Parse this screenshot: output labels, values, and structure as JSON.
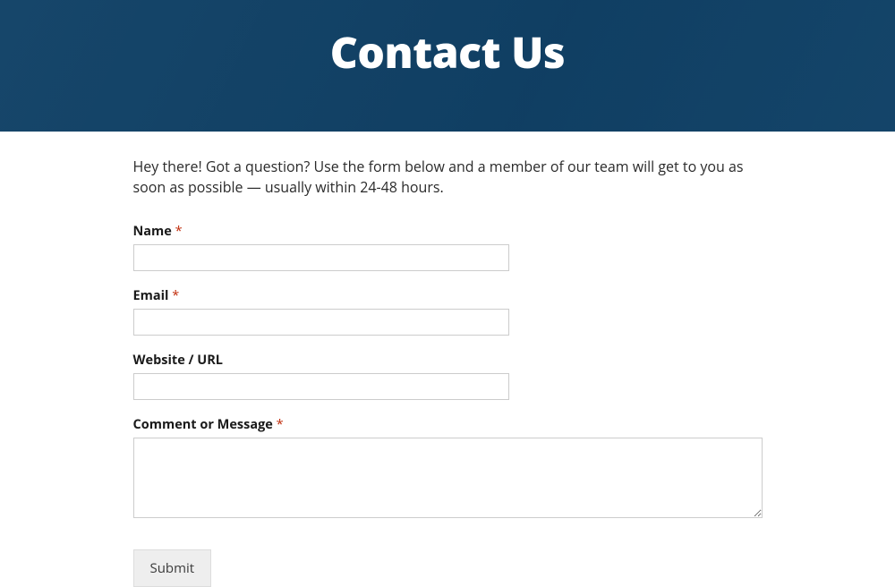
{
  "hero": {
    "title": "Contact Us"
  },
  "intro": "Hey there! Got a question? Use the form below and a member of our team will get to you as soon as possible — usually within 24-48 hours.",
  "form": {
    "name": {
      "label": "Name",
      "required_mark": "*"
    },
    "email": {
      "label": "Email",
      "required_mark": "*"
    },
    "website": {
      "label": "Website / URL"
    },
    "message": {
      "label": "Comment or Message",
      "required_mark": "*"
    },
    "submit_label": "Submit"
  }
}
